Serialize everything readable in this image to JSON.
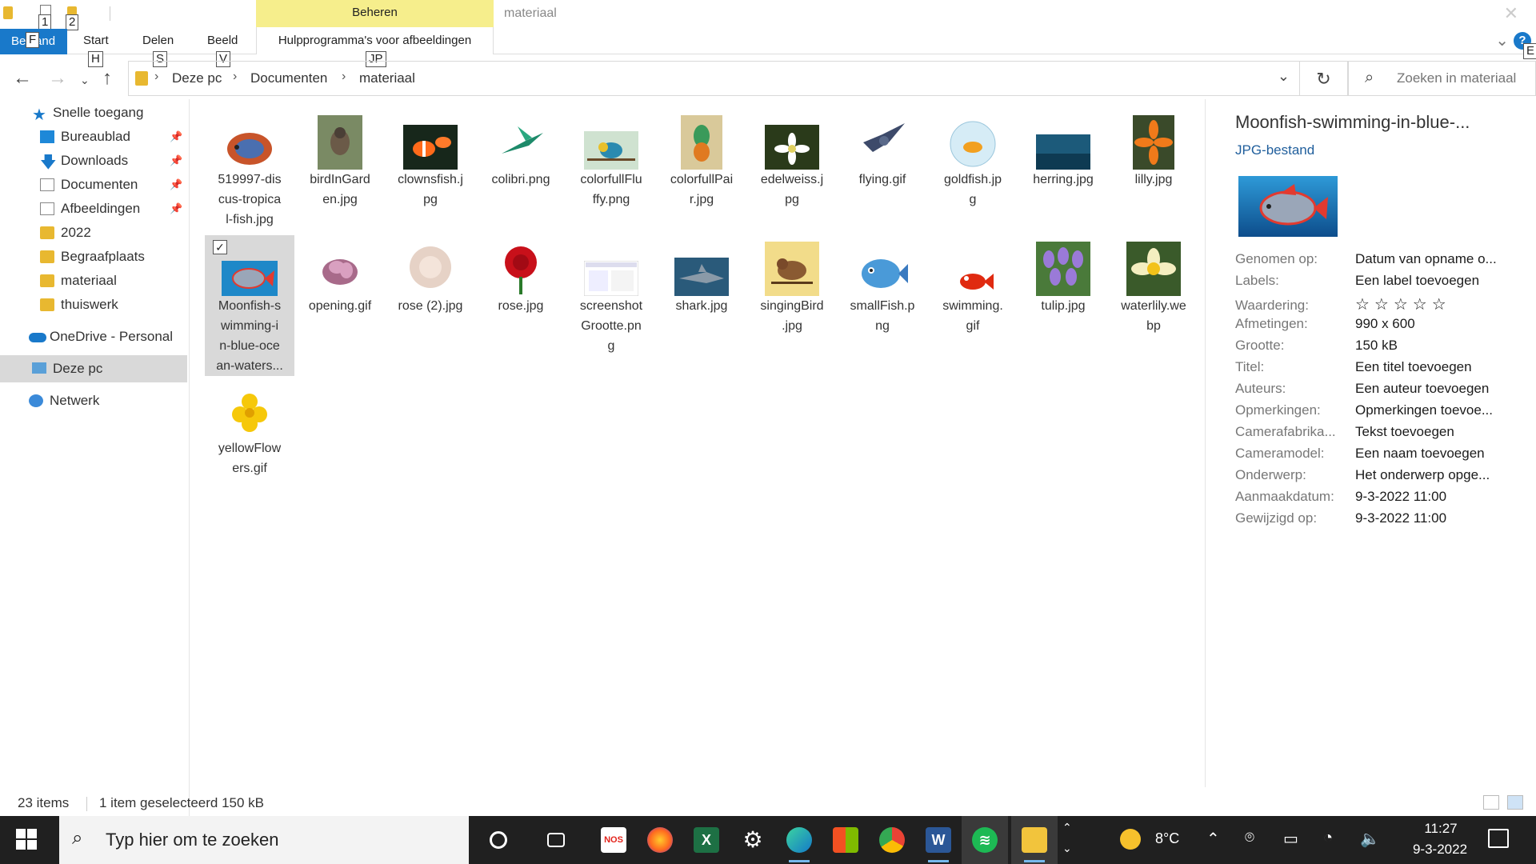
{
  "quick_access": {
    "keytip_1": "1",
    "keytip_2": "2"
  },
  "ribbon": {
    "manage_label": "Beheren",
    "window_title": "materiaal",
    "file_tab": "Bestand",
    "file_keytip": "F",
    "tabs": [
      {
        "label": "Start",
        "keytip": "H"
      },
      {
        "label": "Delen",
        "keytip": "S"
      },
      {
        "label": "Beeld",
        "keytip": "V"
      }
    ],
    "tools_tab": "Hulpprogramma's voor afbeeldingen",
    "tools_keytip": "JP",
    "help_keytip": "E"
  },
  "address": {
    "crumbs": [
      "Deze pc",
      "Documenten",
      "materiaal"
    ],
    "search_placeholder": "Zoeken in materiaal"
  },
  "nav": [
    {
      "label": "Snelle toegang",
      "icon": "star-icon"
    },
    {
      "label": "Bureaublad",
      "icon": "desktop-icon",
      "pinned": true
    },
    {
      "label": "Downloads",
      "icon": "download-icon",
      "pinned": true
    },
    {
      "label": "Documenten",
      "icon": "document-icon",
      "pinned": true
    },
    {
      "label": "Afbeeldingen",
      "icon": "pictures-icon",
      "pinned": true
    },
    {
      "label": "2022",
      "icon": "folder-icon"
    },
    {
      "label": "Begraafplaats",
      "icon": "folder-icon"
    },
    {
      "label": "materiaal",
      "icon": "folder-icon"
    },
    {
      "label": "thuiswerk",
      "icon": "folder-icon"
    },
    {
      "label": "OneDrive - Personal",
      "icon": "onedrive-icon"
    },
    {
      "label": "Deze pc",
      "icon": "pc-icon",
      "selected": true
    },
    {
      "label": "Netwerk",
      "icon": "network-icon"
    }
  ],
  "files": [
    {
      "name": "519997-discus-tropical-fish.jpg",
      "lines": [
        "519997-dis",
        "cus-tropica",
        "l-fish.jpg"
      ]
    },
    {
      "name": "birdInGarden.jpg",
      "lines": [
        "birdInGard",
        "en.jpg"
      ]
    },
    {
      "name": "clownsfish.jpg",
      "lines": [
        "clownsfish.j",
        "pg"
      ]
    },
    {
      "name": "colibri.png",
      "lines": [
        "colibri.png"
      ]
    },
    {
      "name": "colorfullFluffy.png",
      "lines": [
        "colorfullFlu",
        "ffy.png"
      ]
    },
    {
      "name": "colorfullPair.jpg",
      "lines": [
        "colorfullPai",
        "r.jpg"
      ]
    },
    {
      "name": "edelweiss.jpg",
      "lines": [
        "edelweiss.j",
        "pg"
      ]
    },
    {
      "name": "flying.gif",
      "lines": [
        "flying.gif"
      ]
    },
    {
      "name": "goldfish.jpg",
      "lines": [
        "goldfish.jp",
        "g"
      ]
    },
    {
      "name": "herring.jpg",
      "lines": [
        "herring.jpg"
      ]
    },
    {
      "name": "lilly.jpg",
      "lines": [
        "lilly.jpg"
      ]
    },
    {
      "name": "Moonfish-swimming-in-blue-ocean-waters.jpg",
      "lines": [
        "Moonfish-s",
        "wimming-i",
        "n-blue-oce",
        "an-waters..."
      ],
      "selected": true
    },
    {
      "name": "opening.gif",
      "lines": [
        "opening.gif"
      ]
    },
    {
      "name": "rose (2).jpg",
      "lines": [
        "rose (2).jpg"
      ]
    },
    {
      "name": "rose.jpg",
      "lines": [
        "rose.jpg"
      ]
    },
    {
      "name": "screenshotGrootte.png",
      "lines": [
        "screenshot",
        "Grootte.pn",
        "g"
      ]
    },
    {
      "name": "shark.jpg",
      "lines": [
        "shark.jpg"
      ]
    },
    {
      "name": "singingBird.jpg",
      "lines": [
        "singingBird",
        ".jpg"
      ]
    },
    {
      "name": "smallFish.png",
      "lines": [
        "smallFish.p",
        "ng"
      ]
    },
    {
      "name": "swimming.gif",
      "lines": [
        "swimming.",
        "gif"
      ]
    },
    {
      "name": "tulip.jpg",
      "lines": [
        "tulip.jpg"
      ]
    },
    {
      "name": "waterlily.webp",
      "lines": [
        "waterlily.we",
        "bp"
      ]
    },
    {
      "name": "yellowFlowers.gif",
      "lines": [
        "yellowFlow",
        "ers.gif"
      ]
    }
  ],
  "details": {
    "name": "Moonfish-swimming-in-blue-...",
    "type": "JPG-bestand",
    "props": [
      {
        "k": "Genomen op:",
        "v": "Datum van opname o..."
      },
      {
        "k": "Labels:",
        "v": "Een label toevoegen"
      },
      {
        "k": "Waardering:",
        "v": "☆☆☆☆☆"
      },
      {
        "k": "Afmetingen:",
        "v": "990 x 600"
      },
      {
        "k": "Grootte:",
        "v": "150 kB"
      },
      {
        "k": "Titel:",
        "v": "Een titel toevoegen"
      },
      {
        "k": "Auteurs:",
        "v": "Een auteur toevoegen"
      },
      {
        "k": "Opmerkingen:",
        "v": "Opmerkingen toevoe..."
      },
      {
        "k": "Camerafabrika...",
        "v": "Tekst toevoegen"
      },
      {
        "k": "Cameramodel:",
        "v": "Een naam toevoegen"
      },
      {
        "k": "Onderwerp:",
        "v": "Het onderwerp opge..."
      },
      {
        "k": "Aanmaakdatum:",
        "v": "9-3-2022 11:00"
      },
      {
        "k": "Gewijzigd op:",
        "v": "9-3-2022 11:00"
      }
    ]
  },
  "status": {
    "count": "23 items",
    "selection": "1 item geselecteerd  150 kB"
  },
  "taskbar": {
    "search_placeholder": "Typ hier om te zoeken",
    "temperature": "8°C",
    "time": "11:27",
    "date": "9-3-2022",
    "nos_label": "NOS",
    "apps": [
      "cortana",
      "task-view",
      "nos",
      "firefox",
      "excel",
      "settings",
      "edge",
      "store",
      "chrome",
      "word",
      "spotify",
      "file-explorer"
    ]
  }
}
